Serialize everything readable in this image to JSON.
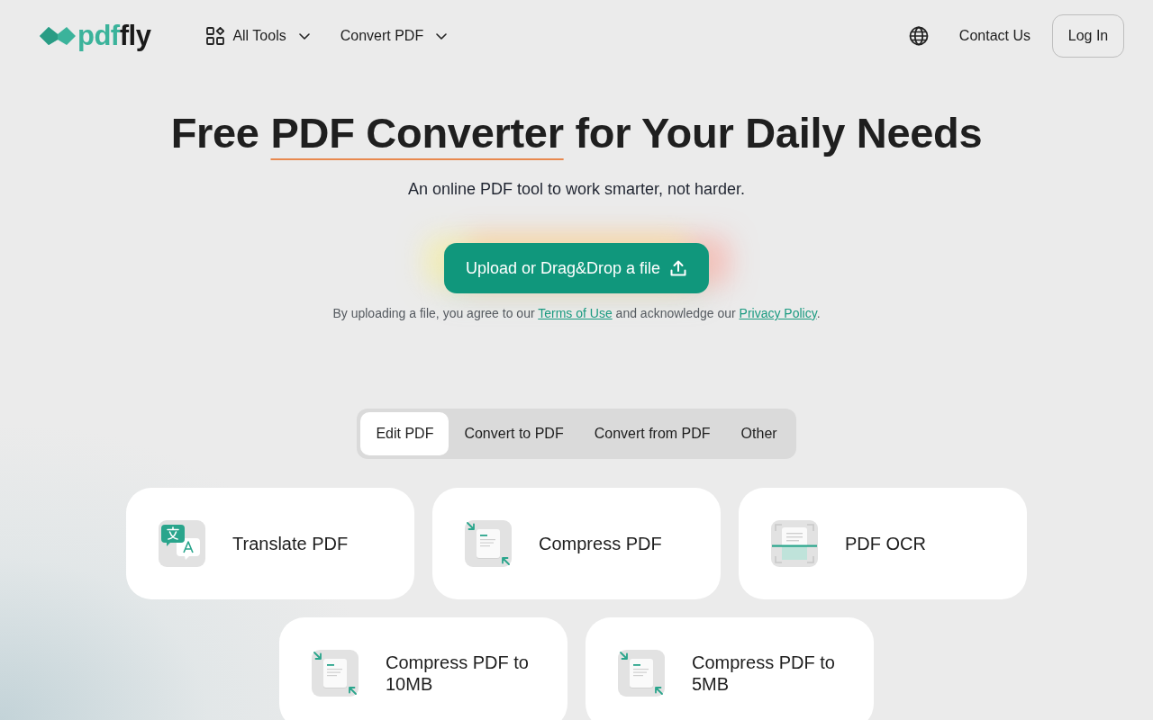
{
  "header": {
    "logo": {
      "text_primary": "pdf",
      "text_secondary": "fly"
    },
    "nav": [
      {
        "label": "All Tools",
        "kind": "grid-menu"
      },
      {
        "label": "Convert PDF",
        "kind": "menu"
      }
    ],
    "contact": "Contact Us",
    "login": "Log In"
  },
  "hero": {
    "title": {
      "before": "Free ",
      "underlined": "PDF Converter",
      "after": " for Your Daily Needs"
    },
    "subtitle": "An online PDF tool to work smarter, not harder.",
    "upload_button": "Upload or Drag&Drop a file",
    "consent": [
      {
        "kind": "text",
        "text": "By uploading a file, you agree to our "
      },
      {
        "kind": "link",
        "text": "Terms of Use"
      },
      {
        "kind": "text",
        "text": " and acknowledge our "
      },
      {
        "kind": "link",
        "text": "Privacy Policy"
      },
      {
        "kind": "text",
        "text": "."
      }
    ]
  },
  "tabs": [
    {
      "label": "Edit PDF",
      "selected": true
    },
    {
      "label": "Convert to PDF",
      "selected": false
    },
    {
      "label": "Convert from PDF",
      "selected": false
    },
    {
      "label": "Other",
      "selected": false
    }
  ],
  "tools": [
    {
      "name": "Translate PDF",
      "kind": "translate"
    },
    {
      "name": "Compress PDF",
      "kind": "compress"
    },
    {
      "name": "PDF OCR",
      "kind": "ocr"
    },
    {
      "name": "Compress PDF to 10MB",
      "kind": "compress"
    },
    {
      "name": "Compress PDF to 5MB",
      "kind": "compress"
    }
  ]
}
